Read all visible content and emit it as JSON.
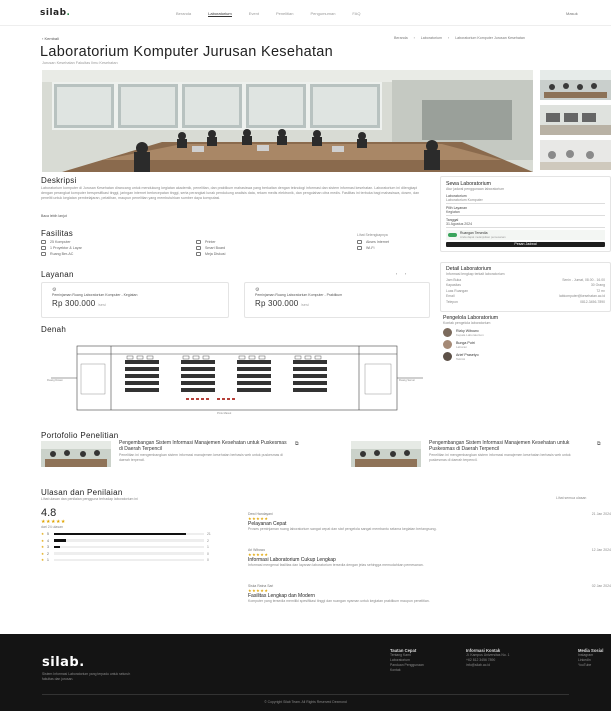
{
  "header": {
    "logo_text": "silab",
    "logo_dot": ".",
    "nav": [
      "Beranda",
      "Laboratorium",
      "Event",
      "Penelitian",
      "Pengumuman",
      "FAQ"
    ],
    "nav_active": "Laboratorium",
    "nav_right": "Masuk"
  },
  "breadcrumb": {
    "back": "‹ Kembali",
    "items": [
      "Beranda",
      "›",
      "Laboratorium",
      "›",
      "Laboratorium Komputer Jurusan Kesehatan"
    ]
  },
  "page": {
    "title": "Laboratorium Komputer Jurusan Kesehatan",
    "subtitle": "Jurusan Kesehatan Fakultas Ilmu Kesehatan"
  },
  "description": {
    "heading": "Deskripsi",
    "text": "Laboratorium komputer di Jurusan Kesehatan dirancang untuk mendukung kegiatan akademik, penelitian, dan praktikum mahasiswa yang berkaitan dengan teknologi informasi dan sistem informasi kesehatan. Laboratorium ini dilengkapi dengan perangkat komputer berspesifikasi tinggi, jaringan internet berkecepatan tinggi, serta perangkat lunak pendukung analisis data, rekam medis elektronik, dan pengolahan citra medis. Fasilitas ini terbuka bagi mahasiswa, dosen, dan peneliti untuk kegiatan pembelajaran, pelatihan, maupun penelitian yang membutuhkan sumber daya komputasi.",
    "read_more": "Baca lebih lanjut"
  },
  "facilities": {
    "heading": "Fasilitas",
    "see_all": "Lihat Selengkapnya",
    "col1": [
      "25 Komputer",
      "1 Proyektor & Layar",
      "Ruang Ber-AC"
    ],
    "col2": [
      "Printer",
      "Smart Board",
      "Meja Diskusi"
    ],
    "col3": [
      "Akses Internet",
      "Wi-Fi"
    ]
  },
  "services": {
    "heading": "Layanan",
    "items": [
      {
        "name": "Peminjaman Ruang Laboratorium Komputer - Kegiatan",
        "price": "Rp 300.000",
        "unit": "/sesi"
      },
      {
        "name": "Peminjaman Ruang Laboratorium Komputer - Praktikum",
        "price": "Rp 300.000",
        "unit": "/sesi"
      }
    ]
  },
  "floorplan": {
    "heading": "Denah",
    "label_left": "Ruang Dosen",
    "label_mid": "Ruang Server",
    "label_bottom": "Pintu Masuk"
  },
  "sidebar": {
    "booking": {
      "heading": "Sewa Laboratorium",
      "sub": "Atur jadwal penggunaan laboratorium",
      "field_lab_label": "Laboratorium",
      "field_lab_value": "Laboratorium Komputer",
      "field_service_label": "Pilih Layanan",
      "field_service_value": "Kegiatan",
      "field_date_label": "Tanggal",
      "field_date_value": "31 Agustus 2024",
      "status_title": "Ruangan Tersedia",
      "status_sub": "Anda dapat melanjutkan pemesanan",
      "button": "Pesan Jadwal"
    },
    "details": {
      "heading": "Detail Laboratorium",
      "sub": "Informasi lengkap terkait laboratorium",
      "rows": [
        {
          "k": "Jam Buka",
          "v": "Senin - Jumat, 08.00 - 16.00"
        },
        {
          "k": "Kapasitas",
          "v": "30 Orang"
        },
        {
          "k": "Luas Ruangan",
          "v": "72 m²"
        },
        {
          "k": "Email",
          "v": "labkomputer@kesehatan.ac.id"
        },
        {
          "k": "Telepon",
          "v": "0812-3456-7890"
        }
      ]
    },
    "managers": {
      "heading": "Pengelola Laboratorium",
      "sub": "Kontak pengelola laboratorium",
      "people": [
        {
          "name": "Rizky Wibowo",
          "role": "Kepala Laboratorium"
        },
        {
          "name": "Bunga Putri",
          "role": "Laboran"
        },
        {
          "name": "Arief Prasetyo",
          "role": "Teknisi"
        }
      ]
    }
  },
  "portfolio": {
    "heading": "Portofolio Penelitian",
    "items": [
      {
        "title": "Pengembangan Sistem Informasi Manajemen Kesehatan untuk Puskesmas di Daerah Terpencil",
        "desc": "Penelitian ini mengembangkan sistem informasi manajemen kesehatan berbasis web untuk puskesmas di daerah terpencil."
      },
      {
        "title": "Pengembangan Sistem Informasi Manajemen Kesehatan untuk Puskesmas di Daerah Terpencil",
        "desc": "Penelitian ini mengembangkan sistem informasi manajemen kesehatan berbasis web untuk puskesmas di daerah terpencil."
      }
    ]
  },
  "reviews": {
    "heading": "Ulasan dan Penilaian",
    "sub": "Lihat ulasan dan penilaian pengguna terhadap laboratorium ini",
    "see_all": "Lihat semua ulasan",
    "average": "4.8",
    "average_stars": "★★★★★",
    "count_text": "dari 24 ulasan",
    "distribution": [
      {
        "label": "5",
        "fraction": 0.88,
        "count": "21"
      },
      {
        "label": "4",
        "fraction": 0.08,
        "count": "2"
      },
      {
        "label": "3",
        "fraction": 0.04,
        "count": "1"
      },
      {
        "label": "2",
        "fraction": 0.0,
        "count": "0"
      },
      {
        "label": "1",
        "fraction": 0.0,
        "count": "0"
      }
    ],
    "items": [
      {
        "author": "Dewi Handayani",
        "stars": "★★★★★",
        "title": "Pelayanan Cepat",
        "text": "Proses peminjaman ruang laboratorium sangat cepat dan staf pengelola sangat membantu selama kegiatan berlangsung.",
        "date": "21 Jan 2024"
      },
      {
        "author": "Ari Wibowo",
        "stars": "★★★★★",
        "title": "Informasi Laboratorium Cukup Lengkap",
        "text": "Informasi mengenai fasilitas dan layanan laboratorium tersedia dengan jelas sehingga memudahkan pemesanan.",
        "date": "12 Jan 2024"
      },
      {
        "author": "Siska Ratna Sari",
        "stars": "★★★★★",
        "title": "Fasilitas Lengkap dan Modern",
        "text": "Komputer yang tersedia memiliki spesifikasi tinggi dan ruangan nyaman untuk kegiatan praktikum maupun penelitian.",
        "date": "02 Jan 2024"
      }
    ]
  },
  "footer": {
    "logo_text": "silab",
    "logo_dot": ".",
    "tagline": "Sistem Informasi Laboratorium yang terpadu untuk seluruh fakultas dan jurusan.",
    "cols": [
      {
        "h": "Tautan Cepat",
        "items": [
          "Tentang Kami",
          "Laboratorium",
          "Panduan Penggunaan",
          "Kontak"
        ]
      },
      {
        "h": "Informasi Kontak",
        "items": [
          "Jl. Kampus Universitas No. 1",
          "+62 812 3456 7890",
          "info@silab.ac.id"
        ]
      },
      {
        "h": "Media Sosial",
        "items": [
          "Instagram",
          "LinkedIn",
          "YouTube"
        ]
      }
    ],
    "copyright": "© Copyright Silab Team. All Rights Reserved Dexmond"
  }
}
